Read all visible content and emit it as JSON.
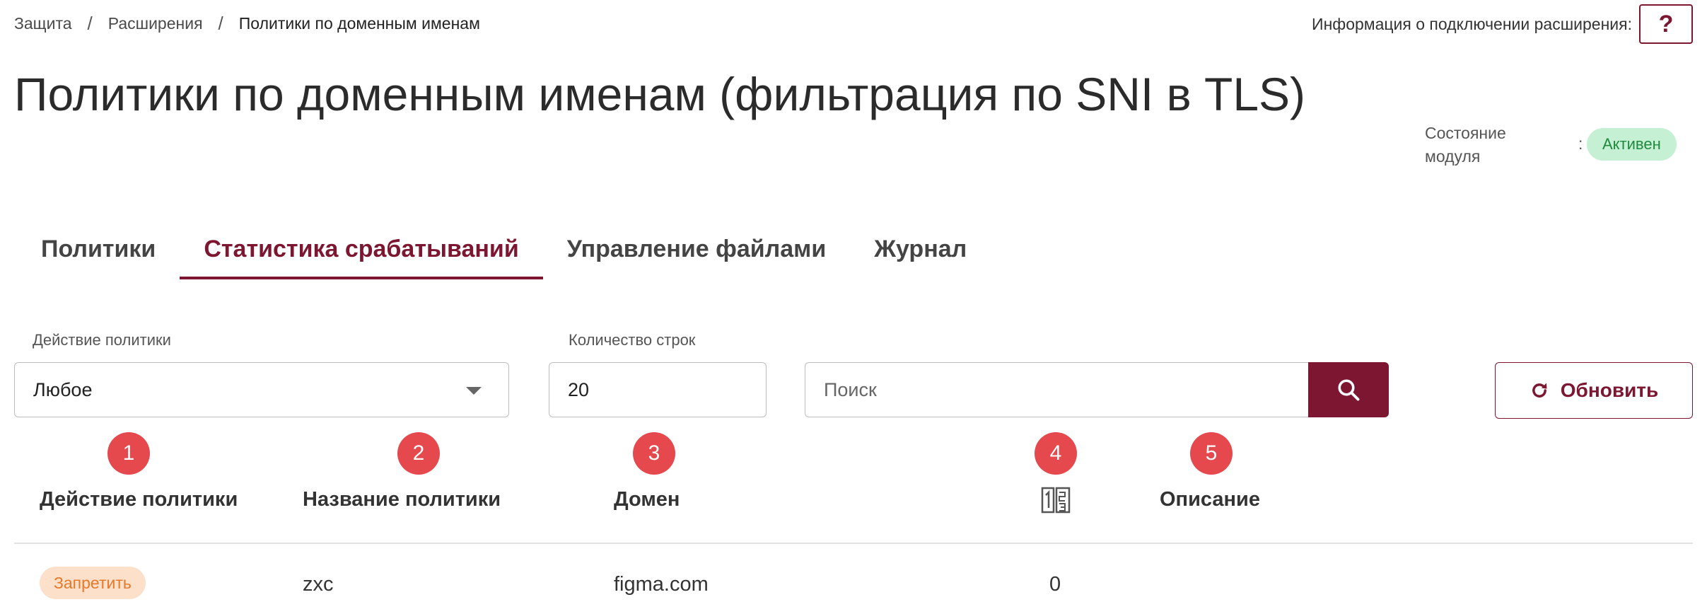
{
  "breadcrumb": {
    "items": [
      "Защита",
      "Расширения"
    ],
    "separator": "/",
    "current": "Политики по доменным именам"
  },
  "connection": {
    "label": "Информация о подключении расширения:",
    "help_label": "?"
  },
  "page": {
    "title": "Политики по доменным именам (фильтрация по SNI в TLS)"
  },
  "module_status": {
    "label": "Состояние модуля",
    "colon": ":",
    "value": "Активен",
    "value_color": "#1f8a3e"
  },
  "tabs": [
    {
      "label": "Политики",
      "active": false
    },
    {
      "label": "Статистика срабатываний",
      "active": true
    },
    {
      "label": "Управление файлами",
      "active": false
    },
    {
      "label": "Журнал",
      "active": false
    }
  ],
  "filters": {
    "action": {
      "label": "Действие политики",
      "value": "Любое"
    },
    "rows": {
      "label": "Количество строк",
      "value": "20"
    },
    "search": {
      "placeholder": "Поиск",
      "value": ""
    },
    "refresh_label": "Обновить"
  },
  "markers": [
    "1",
    "2",
    "3",
    "4",
    "5"
  ],
  "table": {
    "columns": [
      {
        "label": "Действие политики"
      },
      {
        "label": "Название политики"
      },
      {
        "label": "Домен"
      },
      {
        "label": "",
        "icon": "numeric-sort-icon"
      },
      {
        "label": "Описание"
      }
    ],
    "rows": [
      {
        "action": "Запретить",
        "name": "zxc",
        "domain": "figma.com",
        "count": "0",
        "description": ""
      }
    ]
  },
  "colors": {
    "accent": "#7d1631",
    "marker": "#e5484d",
    "active_badge_bg": "#c6f0d4",
    "deny_badge_bg": "#fde0c9",
    "deny_badge_text": "#e8782a"
  }
}
